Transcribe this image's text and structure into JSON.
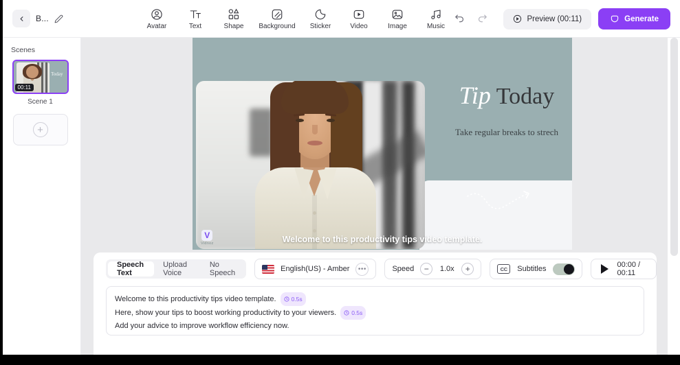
{
  "header": {
    "back_icon": "chevron-left-icon",
    "project_title": "B...",
    "edit_icon": "pencil-icon",
    "tools": [
      {
        "label": "Avatar",
        "icon": "avatar-icon"
      },
      {
        "label": "Text",
        "icon": "text-icon"
      },
      {
        "label": "Shape",
        "icon": "shape-icon"
      },
      {
        "label": "Background",
        "icon": "background-icon"
      },
      {
        "label": "Sticker",
        "icon": "sticker-icon"
      },
      {
        "label": "Video",
        "icon": "video-icon"
      },
      {
        "label": "Image",
        "icon": "image-icon"
      },
      {
        "label": "Music",
        "icon": "music-icon"
      }
    ],
    "undo_icon": "undo-icon",
    "redo_icon": "redo-icon",
    "preview_label": "Preview (00:11)",
    "preview_icon": "play-circle-icon",
    "generate_label": "Generate",
    "generate_icon": "sparkle-icon",
    "accent_color": "#8b3ff5"
  },
  "sidebar": {
    "title": "Scenes",
    "scenes": [
      {
        "name": "Scene 1",
        "duration": "00:11",
        "selected": true
      }
    ],
    "add_scene_icon": "plus-icon"
  },
  "canvas": {
    "background_color": "#9aafb1",
    "title_italic": "Tip",
    "title_regular": "Today",
    "subtitle": "Take regular breaks to strech",
    "squiggle_icon": "dotted-arrow-icon",
    "caption": "Welcome to this productivity tips video template.",
    "logo_mark": "V",
    "logo_text": "Vidnoz",
    "collapse_icon": "chevron-down-icon"
  },
  "controls": {
    "voice_tabs": [
      {
        "label": "Speech Text",
        "active": true
      },
      {
        "label": "Upload Voice",
        "active": false
      },
      {
        "label": "No Speech",
        "active": false
      }
    ],
    "flag_icon": "us-flag-icon",
    "voice_name": "English(US) - Amber",
    "more_icon": "ellipsis-icon",
    "speed_label": "Speed",
    "speed_minus_icon": "minus-circle-icon",
    "speed_value": "1.0x",
    "speed_plus_icon": "plus-circle-icon",
    "cc_icon": "cc-icon",
    "subtitles_label": "Subtitles",
    "subtitles_on": true,
    "play_icon": "play-icon",
    "time_display": "00:00 / 00:11"
  },
  "script": {
    "lines": [
      {
        "text": "Welcome to this productivity tips video template.",
        "pause": "0.5s"
      },
      {
        "text": "Here, show your tips to boost working productivity to your viewers.",
        "pause": "0.5s"
      },
      {
        "text": "Add your advice to improve workflow efficiency now.",
        "pause": ""
      }
    ],
    "pause_icon": "clock-icon"
  }
}
